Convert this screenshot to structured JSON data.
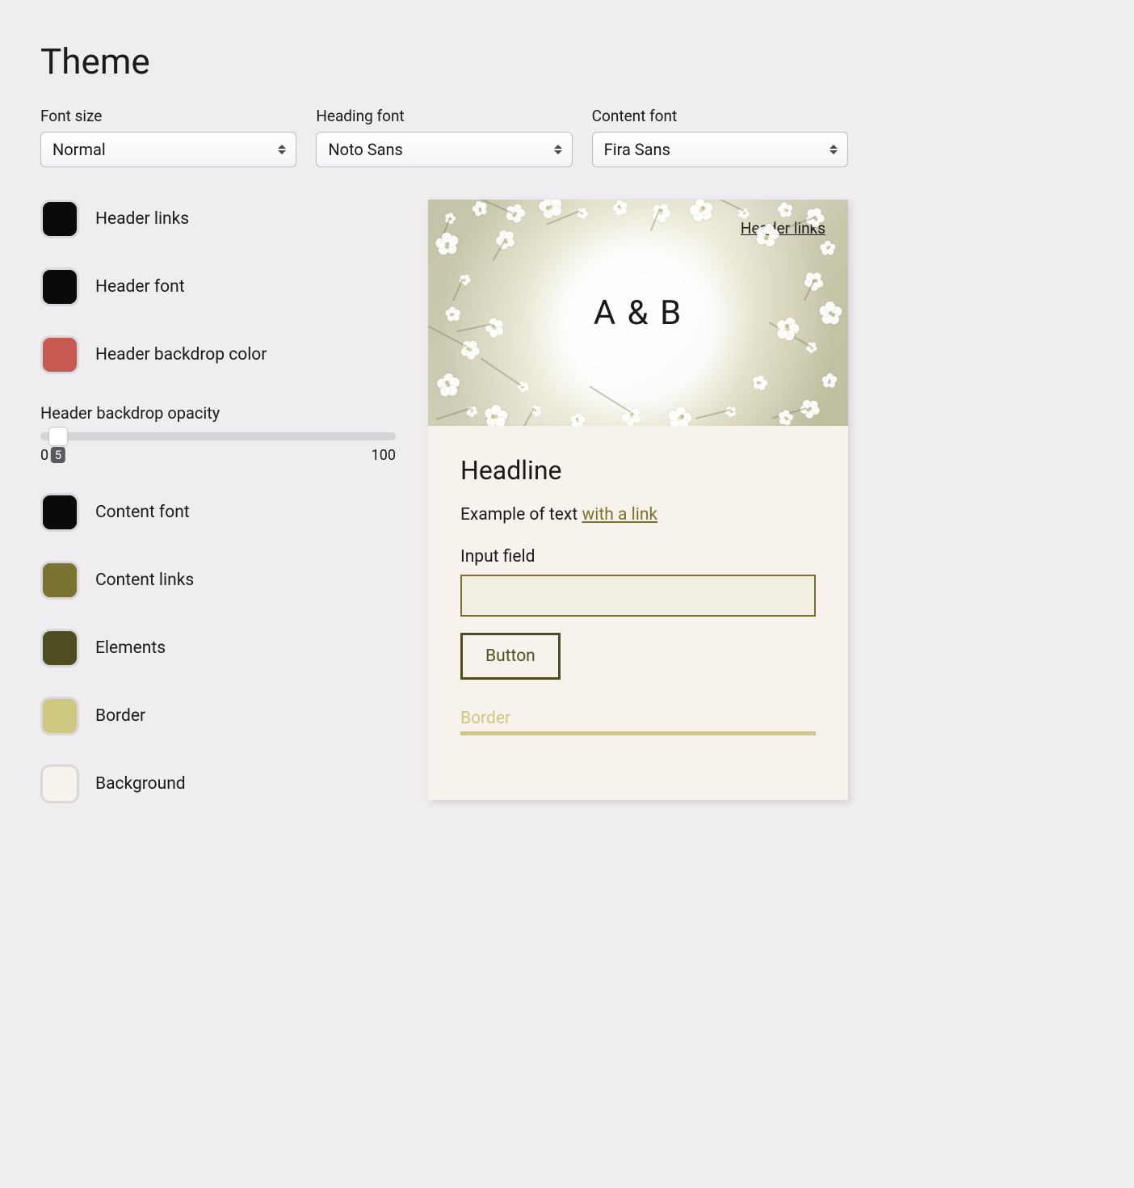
{
  "page_title": "Theme",
  "fonts": {
    "size": {
      "label": "Font size",
      "value": "Normal"
    },
    "heading": {
      "label": "Heading font",
      "value": "Noto Sans"
    },
    "content": {
      "label": "Content font",
      "value": "Fira Sans"
    }
  },
  "colors": {
    "header_links": {
      "label": "Header links",
      "hex": "#0a0a0a"
    },
    "header_font": {
      "label": "Header font",
      "hex": "#0a0a0a"
    },
    "header_backdrop": {
      "label": "Header backdrop color",
      "hex": "#c65a50"
    },
    "content_font": {
      "label": "Content font",
      "hex": "#0a0a0a"
    },
    "content_links": {
      "label": "Content links",
      "hex": "#7a7230"
    },
    "elements": {
      "label": "Elements",
      "hex": "#4f4d1f"
    },
    "border": {
      "label": "Border",
      "hex": "#cec77f"
    },
    "background": {
      "label": "Background",
      "hex": "#f7f3ec"
    }
  },
  "opacity": {
    "label": "Header backdrop opacity",
    "min": "0",
    "max": "100",
    "value": "5",
    "percent": 5
  },
  "preview": {
    "header_link": "Header links",
    "title": "A & B",
    "headline": "Headline",
    "text_prefix": "Example of text ",
    "link_text": "with a link",
    "input_label": "Input field",
    "button_label": "Button",
    "border_label": "Border"
  }
}
